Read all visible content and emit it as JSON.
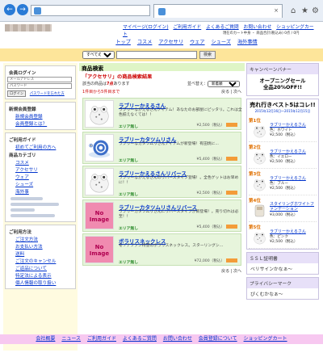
{
  "browser": {
    "address_text": "",
    "tab_text": "",
    "back_glyph": "←",
    "forward_glyph": "→",
    "close_glyph": "×"
  },
  "header": {
    "nav": [
      "マイページ(ログイン)",
      "ご利用ガイド",
      "よくあるご質問",
      "お問い合わせ",
      "ショッピングカート"
    ],
    "cart_info": "現在のカート中身 ・ 商品合計(税込み)  0点 /  0円",
    "categories": [
      "トップ",
      "コスメ",
      "アクセサリ",
      "ウェア",
      "シューズ",
      "海外事情"
    ]
  },
  "search": {
    "select_value": "すべての商品",
    "button": "検索"
  },
  "left": {
    "login_title": "会員ログイン",
    "mail_placeholder": "メールアドレス",
    "pass_placeholder": "パスワード",
    "login_btn": "ログイン",
    "forgot": "パスワードを忘れた方",
    "member_title": "新規会員登録",
    "member_links": [
      "新規会員登録",
      "会員登録とは？"
    ],
    "guide_title": "ご利用ガイド",
    "guide_first": "初めてご利用の方へ",
    "cat_title": "商品カテゴリ",
    "cats": [
      "コスメ",
      "アクセサリ",
      "ウェア",
      "シューズ",
      "海外事"
    ],
    "use_title": "ご利用方法",
    "use_links": [
      "ご注文方法",
      "お支払い方法",
      "送料",
      "ご注文のキャンセル",
      "ご返品について",
      "特定法による表示",
      "個人情報の取り扱い"
    ]
  },
  "main": {
    "title": "商品検索",
    "result_title": "「アクセサリ」の商品検索結果",
    "count_prefix": "該当の商品は",
    "count": "7点",
    "count_suffix": "あります",
    "sort_label": "並べ替え：",
    "sort_value": "新着順",
    "pager_left": "1件目から5件目まで",
    "pager_right": "戻る | 次へ",
    "pager_bottom": "戻る | 次へ",
    "items": [
      {
        "name": "ラブリーかえるさん",
        "desc": "ラブリーなかえるさんアイテム！あなたのお部屋にピッタリ。これは全色揃えなくては！！",
        "area": "エリア無し",
        "price": "¥2,500（税込）",
        "img": "frog"
      },
      {
        "name": "ラブリーカタツムリさん",
        "desc": "ラブリーなカタツムリさんアイテムが新登場！有田焼に...",
        "area": "エリア無し",
        "price": "¥5,400（税込）",
        "img": "snail"
      },
      {
        "name": "ラブリーかえるさんリバース",
        "desc": "ラブリーなかえるさんのリバースタイプ登場！。全色ゲットはお早めに！！",
        "area": "エリア無し",
        "price": "¥2,500（税込）",
        "img": "frog"
      },
      {
        "name": "ラブリーカタツムリさんリバース",
        "desc": "ラブリーカタツムリさんにリバースタイプが新登場！。売り切れは必至！！",
        "area": "エリア無し",
        "price": "¥5,400（税込）",
        "img": "none"
      },
      {
        "name": "ボラリスネックレス",
        "desc": "冬ソナファン待望のボラリスネックレス。スターリングシ...",
        "area": "エリア無し",
        "price": "¥72,000（税込）",
        "img": "none"
      }
    ],
    "no_image": "No Image"
  },
  "right": {
    "banner_title": "キャンペーンバナー",
    "banner_text": "オープニングセール\n全品20%OFF!!",
    "rank_head": "売れ行きベスト5はコレ!!",
    "rank_date": "2015年12月16日〜2015年12月15日",
    "ranks": [
      {
        "rank": "第1位",
        "name": "ラブリーかえるさん",
        "color": "色：ホワイト",
        "price": "¥2,500（税込）"
      },
      {
        "rank": "第2位",
        "name": "ラブリーかえるさん",
        "color": "色：イエロー",
        "price": "¥2,500（税込）"
      },
      {
        "rank": "第3位",
        "name": "ラブリーかえるさん",
        "color": "色：ブルー",
        "price": "¥2,500（税込）"
      },
      {
        "rank": "第4位",
        "name": "スタイリングホワイトファンデーション",
        "color": "",
        "price": "¥3,000（税込）"
      },
      {
        "rank": "第5位",
        "name": "ラブリーかえるさん",
        "color": "色：ピンク",
        "price": "¥2,500（税込）"
      }
    ],
    "ssl_title": "ＳＳＬ証明書",
    "ssl_text": "ベリサインかなぁ〜",
    "privacy_title": "プライバシーマーク",
    "privacy_text": "ぴくむかなぁ〜"
  },
  "footer": [
    "会社概要",
    "ニュース",
    "ご利用ガイド",
    "よくあるご質問",
    "お問い合わせ",
    "会員登録について",
    "ショッピングカート"
  ]
}
